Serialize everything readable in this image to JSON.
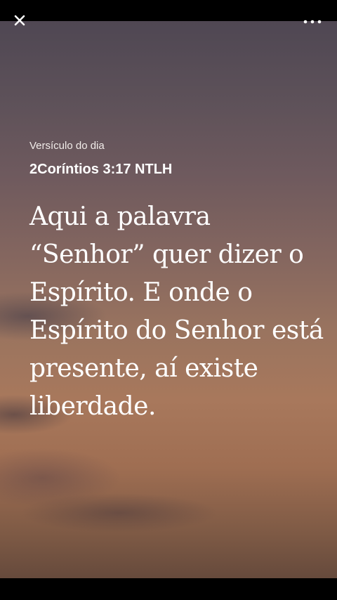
{
  "verse_of_day": {
    "kicker": "Versículo do dia",
    "reference": "2Coríntios 3:17 NTLH",
    "text": "Aqui a palavra “Senhor” quer dizer o Espírito. E onde o Espírito do Senhor está presente, aí existe liberdade."
  },
  "controls": {
    "close_icon": "close-icon",
    "more_icon": "more-options-icon"
  },
  "colors": {
    "text": "#ffffff",
    "sky_top": "#4f4753",
    "sky_bottom": "#664a3c"
  }
}
